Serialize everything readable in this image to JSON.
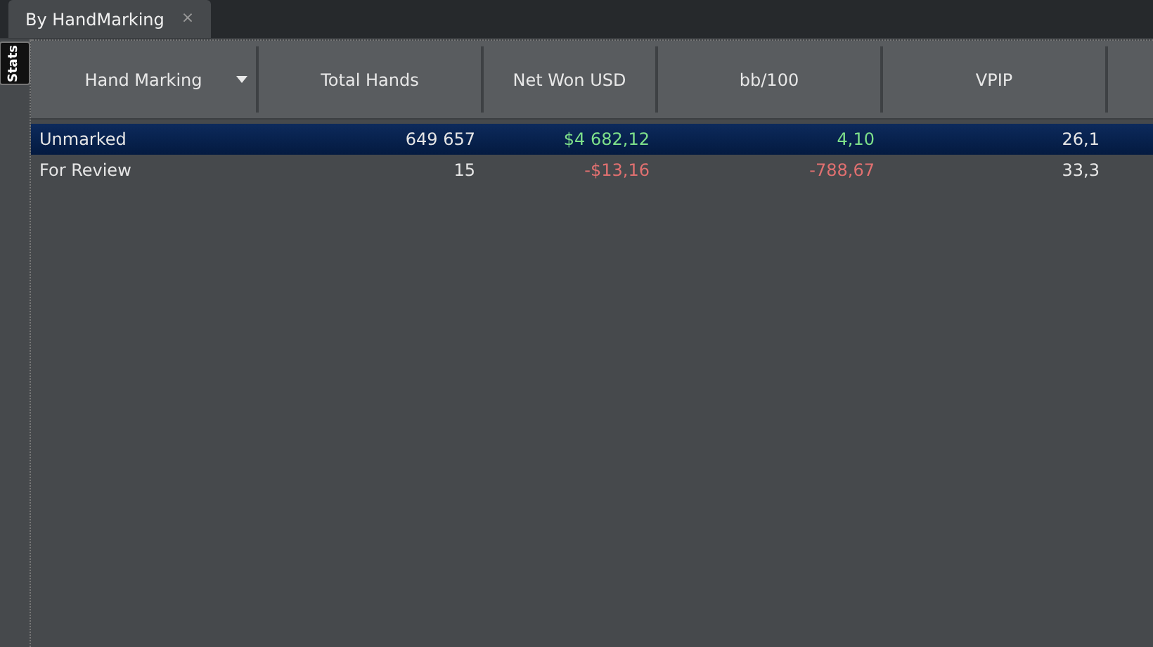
{
  "tabs": [
    {
      "label": "By HandMarking",
      "close": "×",
      "selected": true
    }
  ],
  "side_tab": {
    "label": "Stats"
  },
  "table": {
    "columns": [
      {
        "label": "Hand Marking",
        "sort_caret": true
      },
      {
        "label": "Total Hands",
        "sort_caret": false
      },
      {
        "label": "Net Won USD",
        "sort_caret": false
      },
      {
        "label": "bb/100",
        "sort_caret": false
      },
      {
        "label": "VPIP",
        "sort_caret": false
      }
    ],
    "rows": [
      {
        "selected": true,
        "cells": [
          {
            "text": "Unmarked",
            "color": "#e6e6e6"
          },
          {
            "text": "649 657",
            "color": "#e6e6e6"
          },
          {
            "text": "$4 682,12",
            "color": "#7ee08a"
          },
          {
            "text": "4,10",
            "color": "#7ee08a"
          },
          {
            "text": "26,1",
            "color": "#e6e6e6"
          }
        ]
      },
      {
        "selected": false,
        "cells": [
          {
            "text": "For Review",
            "color": "#e6e6e6"
          },
          {
            "text": "15",
            "color": "#e6e6e6"
          },
          {
            "text": "-$13,16",
            "color": "#e07070"
          },
          {
            "text": "-788,67",
            "color": "#e07070"
          },
          {
            "text": "33,3",
            "color": "#e6e6e6"
          }
        ]
      }
    ]
  }
}
